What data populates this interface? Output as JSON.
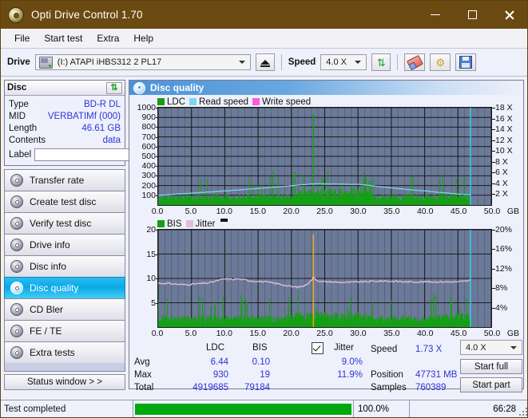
{
  "window": {
    "title": "Opti Drive Control 1.70",
    "icon": "disc-icon",
    "minimize": "─",
    "maximize": "□",
    "close": "✕"
  },
  "menu": {
    "items": [
      "File",
      "Start test",
      "Extra",
      "Help"
    ]
  },
  "toolbar": {
    "drive_label": "Drive",
    "drive_value": "(I:)  ATAPI iHBS312  2 PL17",
    "eject_title": "eject",
    "speed_label": "Speed",
    "speed_value": "4.0 X",
    "refresh_icon": "refresh-icon",
    "eraser_icon": "eraser-icon",
    "tools_icon": "tools-icon",
    "save_icon": "save-icon"
  },
  "disc": {
    "panel_title": "Disc",
    "refresh_icon": "refresh-icon",
    "rows": [
      {
        "key": "Type",
        "value": "BD-R DL"
      },
      {
        "key": "MID",
        "value": "VERBATIMf (000)"
      },
      {
        "key": "Length",
        "value": "46.61 GB"
      },
      {
        "key": "Contents",
        "value": "data"
      }
    ],
    "label_key": "Label",
    "label_value": "",
    "label_icon": "cd-icon"
  },
  "nav": {
    "items": [
      {
        "label": "Transfer rate",
        "active": false
      },
      {
        "label": "Create test disc",
        "active": false
      },
      {
        "label": "Verify test disc",
        "active": false
      },
      {
        "label": "Drive info",
        "active": false
      },
      {
        "label": "Disc info",
        "active": false
      },
      {
        "label": "Disc quality",
        "active": true
      },
      {
        "label": "CD Bler",
        "active": false
      },
      {
        "label": "FE / TE",
        "active": false
      },
      {
        "label": "Extra tests",
        "active": false
      }
    ],
    "status_window": "Status window > >"
  },
  "content": {
    "title": "Disc quality",
    "icon": "disc-quality-icon"
  },
  "stats": {
    "col_ldc": "LDC",
    "col_bis": "BIS",
    "jitter_label": "Jitter",
    "jitter_checked": true,
    "rows": [
      {
        "name": "Avg",
        "ldc": "6.44",
        "bis": "0.10",
        "jitter": "9.0%"
      },
      {
        "name": "Max",
        "ldc": "930",
        "bis": "19",
        "jitter": "11.9%"
      },
      {
        "name": "Total",
        "ldc": "4919685",
        "bis": "79184",
        "jitter": ""
      }
    ],
    "speed_label": "Speed",
    "speed_value": "1.73 X",
    "position_label": "Position",
    "position_value": "47731 MB",
    "samples_label": "Samples",
    "samples_value": "760389",
    "speed_select": "4.0 X",
    "start_full": "Start full",
    "start_part": "Start part"
  },
  "statusbar": {
    "message": "Test completed",
    "percent": "100.0%",
    "progress": 100,
    "elapsed": "66:28"
  },
  "chart_data": [
    {
      "type": "line",
      "title": "Disc quality - LDC / Read speed",
      "legend": [
        {
          "label": "LDC",
          "color": "#14a014"
        },
        {
          "label": "Read speed",
          "color": "#7fd6f2"
        },
        {
          "label": "Write speed",
          "color": "#ff5ae0"
        }
      ],
      "legend_position": "top-left",
      "grid": true,
      "xlabel": "GB",
      "xlim": [
        0,
        50
      ],
      "xticks": [
        0.0,
        5.0,
        10.0,
        15.0,
        20.0,
        25.0,
        30.0,
        35.0,
        40.0,
        45.0,
        50.0
      ],
      "xticklabels": [
        "0.0",
        "5.0",
        "10.0",
        "15.0",
        "20.0",
        "25.0",
        "30.0",
        "35.0",
        "40.0",
        "45.0",
        "50.0"
      ],
      "ylabel": "LDC",
      "ylim": [
        0,
        1000
      ],
      "yticks": [
        100,
        200,
        300,
        400,
        500,
        600,
        700,
        800,
        900,
        1000
      ],
      "y2label": "Speed",
      "y2lim": [
        0,
        18
      ],
      "y2ticks": [
        2,
        4,
        6,
        8,
        10,
        12,
        14,
        16,
        18
      ],
      "y2ticklabels": [
        "2 X",
        "4 X",
        "6 X",
        "8 X",
        "10 X",
        "12 X",
        "14 X",
        "16 X",
        "18 X"
      ],
      "series": [
        {
          "name": "Read speed",
          "color": "#7fd6f2",
          "axis": "y2",
          "x": [
            0,
            1,
            2,
            3,
            4,
            5,
            6,
            7,
            8,
            9,
            10,
            11,
            12,
            13,
            14,
            15,
            16,
            17,
            18,
            19,
            20,
            21,
            22,
            23,
            24,
            25,
            26,
            27,
            28,
            29,
            30,
            31,
            32,
            33,
            34,
            35,
            36,
            37,
            38,
            39,
            40,
            41,
            42,
            43,
            44,
            45,
            46,
            46.9
          ],
          "values": [
            1.78,
            1.86,
            1.95,
            2.05,
            2.13,
            2.2,
            2.28,
            2.36,
            2.44,
            2.52,
            2.6,
            2.68,
            2.78,
            2.87,
            2.96,
            3.06,
            3.16,
            3.26,
            3.36,
            3.47,
            3.58,
            3.68,
            3.8,
            3.9,
            3.95,
            3.9,
            3.88,
            3.9,
            3.86,
            3.8,
            3.84,
            3.7,
            3.56,
            3.42,
            3.3,
            3.18,
            3.05,
            2.93,
            2.8,
            2.7,
            2.6,
            2.48,
            2.35,
            2.25,
            2.15,
            2.05,
            1.95,
            1.9
          ]
        },
        {
          "name": "LDC",
          "color": "#14a014",
          "axis": "y1",
          "note": "dense spike bars across 0-47 GB, baseline ~40-120, peak 930 at ~23.3 GB",
          "baseline": 60,
          "peak_value": 930,
          "peak_x": 23.3
        }
      ],
      "cursor_x": 46.9,
      "cursor_color": "#3fd0f5"
    },
    {
      "type": "line",
      "title": "Disc quality - BIS / Jitter",
      "legend": [
        {
          "label": "BIS",
          "color": "#14a014"
        },
        {
          "label": "Jitter",
          "color": "#e3bbdd"
        }
      ],
      "legend_position": "top-left",
      "grid": true,
      "xlabel": "GB",
      "xlim": [
        0,
        50
      ],
      "xticks": [
        0.0,
        5.0,
        10.0,
        15.0,
        20.0,
        25.0,
        30.0,
        35.0,
        40.0,
        45.0,
        50.0
      ],
      "xticklabels": [
        "0.0",
        "5.0",
        "10.0",
        "15.0",
        "20.0",
        "25.0",
        "30.0",
        "35.0",
        "40.0",
        "45.0",
        "50.0"
      ],
      "ylabel": "BIS",
      "ylim": [
        0,
        20
      ],
      "yticks": [
        5,
        10,
        15,
        20
      ],
      "y2label": "Jitter",
      "y2lim": [
        0,
        20
      ],
      "y2ticks": [
        4,
        8,
        12,
        16,
        20
      ],
      "y2ticklabels": [
        "4%",
        "8%",
        "12%",
        "16%",
        "20%"
      ],
      "series": [
        {
          "name": "Jitter",
          "color": "#e3bbdd",
          "axis": "y2",
          "x": [
            0,
            1,
            2,
            3,
            4,
            5,
            6,
            7,
            8,
            9,
            10,
            11,
            12,
            13,
            14,
            15,
            16,
            17,
            18,
            19,
            20,
            21,
            22,
            23,
            23.3,
            24,
            25,
            26,
            27,
            28,
            29,
            30,
            31,
            32,
            33,
            34,
            35,
            36,
            37,
            38,
            39,
            40,
            41,
            42,
            43,
            44,
            45,
            46,
            46.9
          ],
          "values": [
            9.0,
            9.0,
            8.9,
            8.8,
            8.7,
            8.8,
            8.9,
            9.0,
            9.2,
            9.6,
            9.9,
            9.8,
            9.9,
            9.7,
            9.5,
            9.4,
            9.3,
            9.1,
            8.9,
            8.6,
            8.3,
            8.2,
            8.5,
            9.6,
            10.2,
            9.5,
            9.3,
            9.3,
            9.2,
            9.2,
            9.2,
            9.3,
            9.3,
            9.4,
            9.4,
            9.5,
            9.4,
            9.4,
            9.3,
            9.3,
            9.3,
            9.3,
            9.3,
            9.3,
            9.3,
            9.3,
            9.3,
            9.4,
            9.6
          ]
        },
        {
          "name": "BIS",
          "color": "#14a014",
          "axis": "y1",
          "note": "dense spike bars across 0-47 GB, baseline ~2, occasional spikes to 5-6",
          "baseline": 2,
          "peak_value": 6,
          "peak_x": 25.3
        },
        {
          "name": "Jitter peak marker",
          "color": "#f0a818",
          "axis": "y1",
          "note": "orange vertical spike at 23.3 GB reaching 19",
          "peak_value": 19,
          "peak_x": 23.3
        }
      ],
      "cursor_x": 46.9,
      "cursor_color": "#3fd0f5"
    }
  ]
}
